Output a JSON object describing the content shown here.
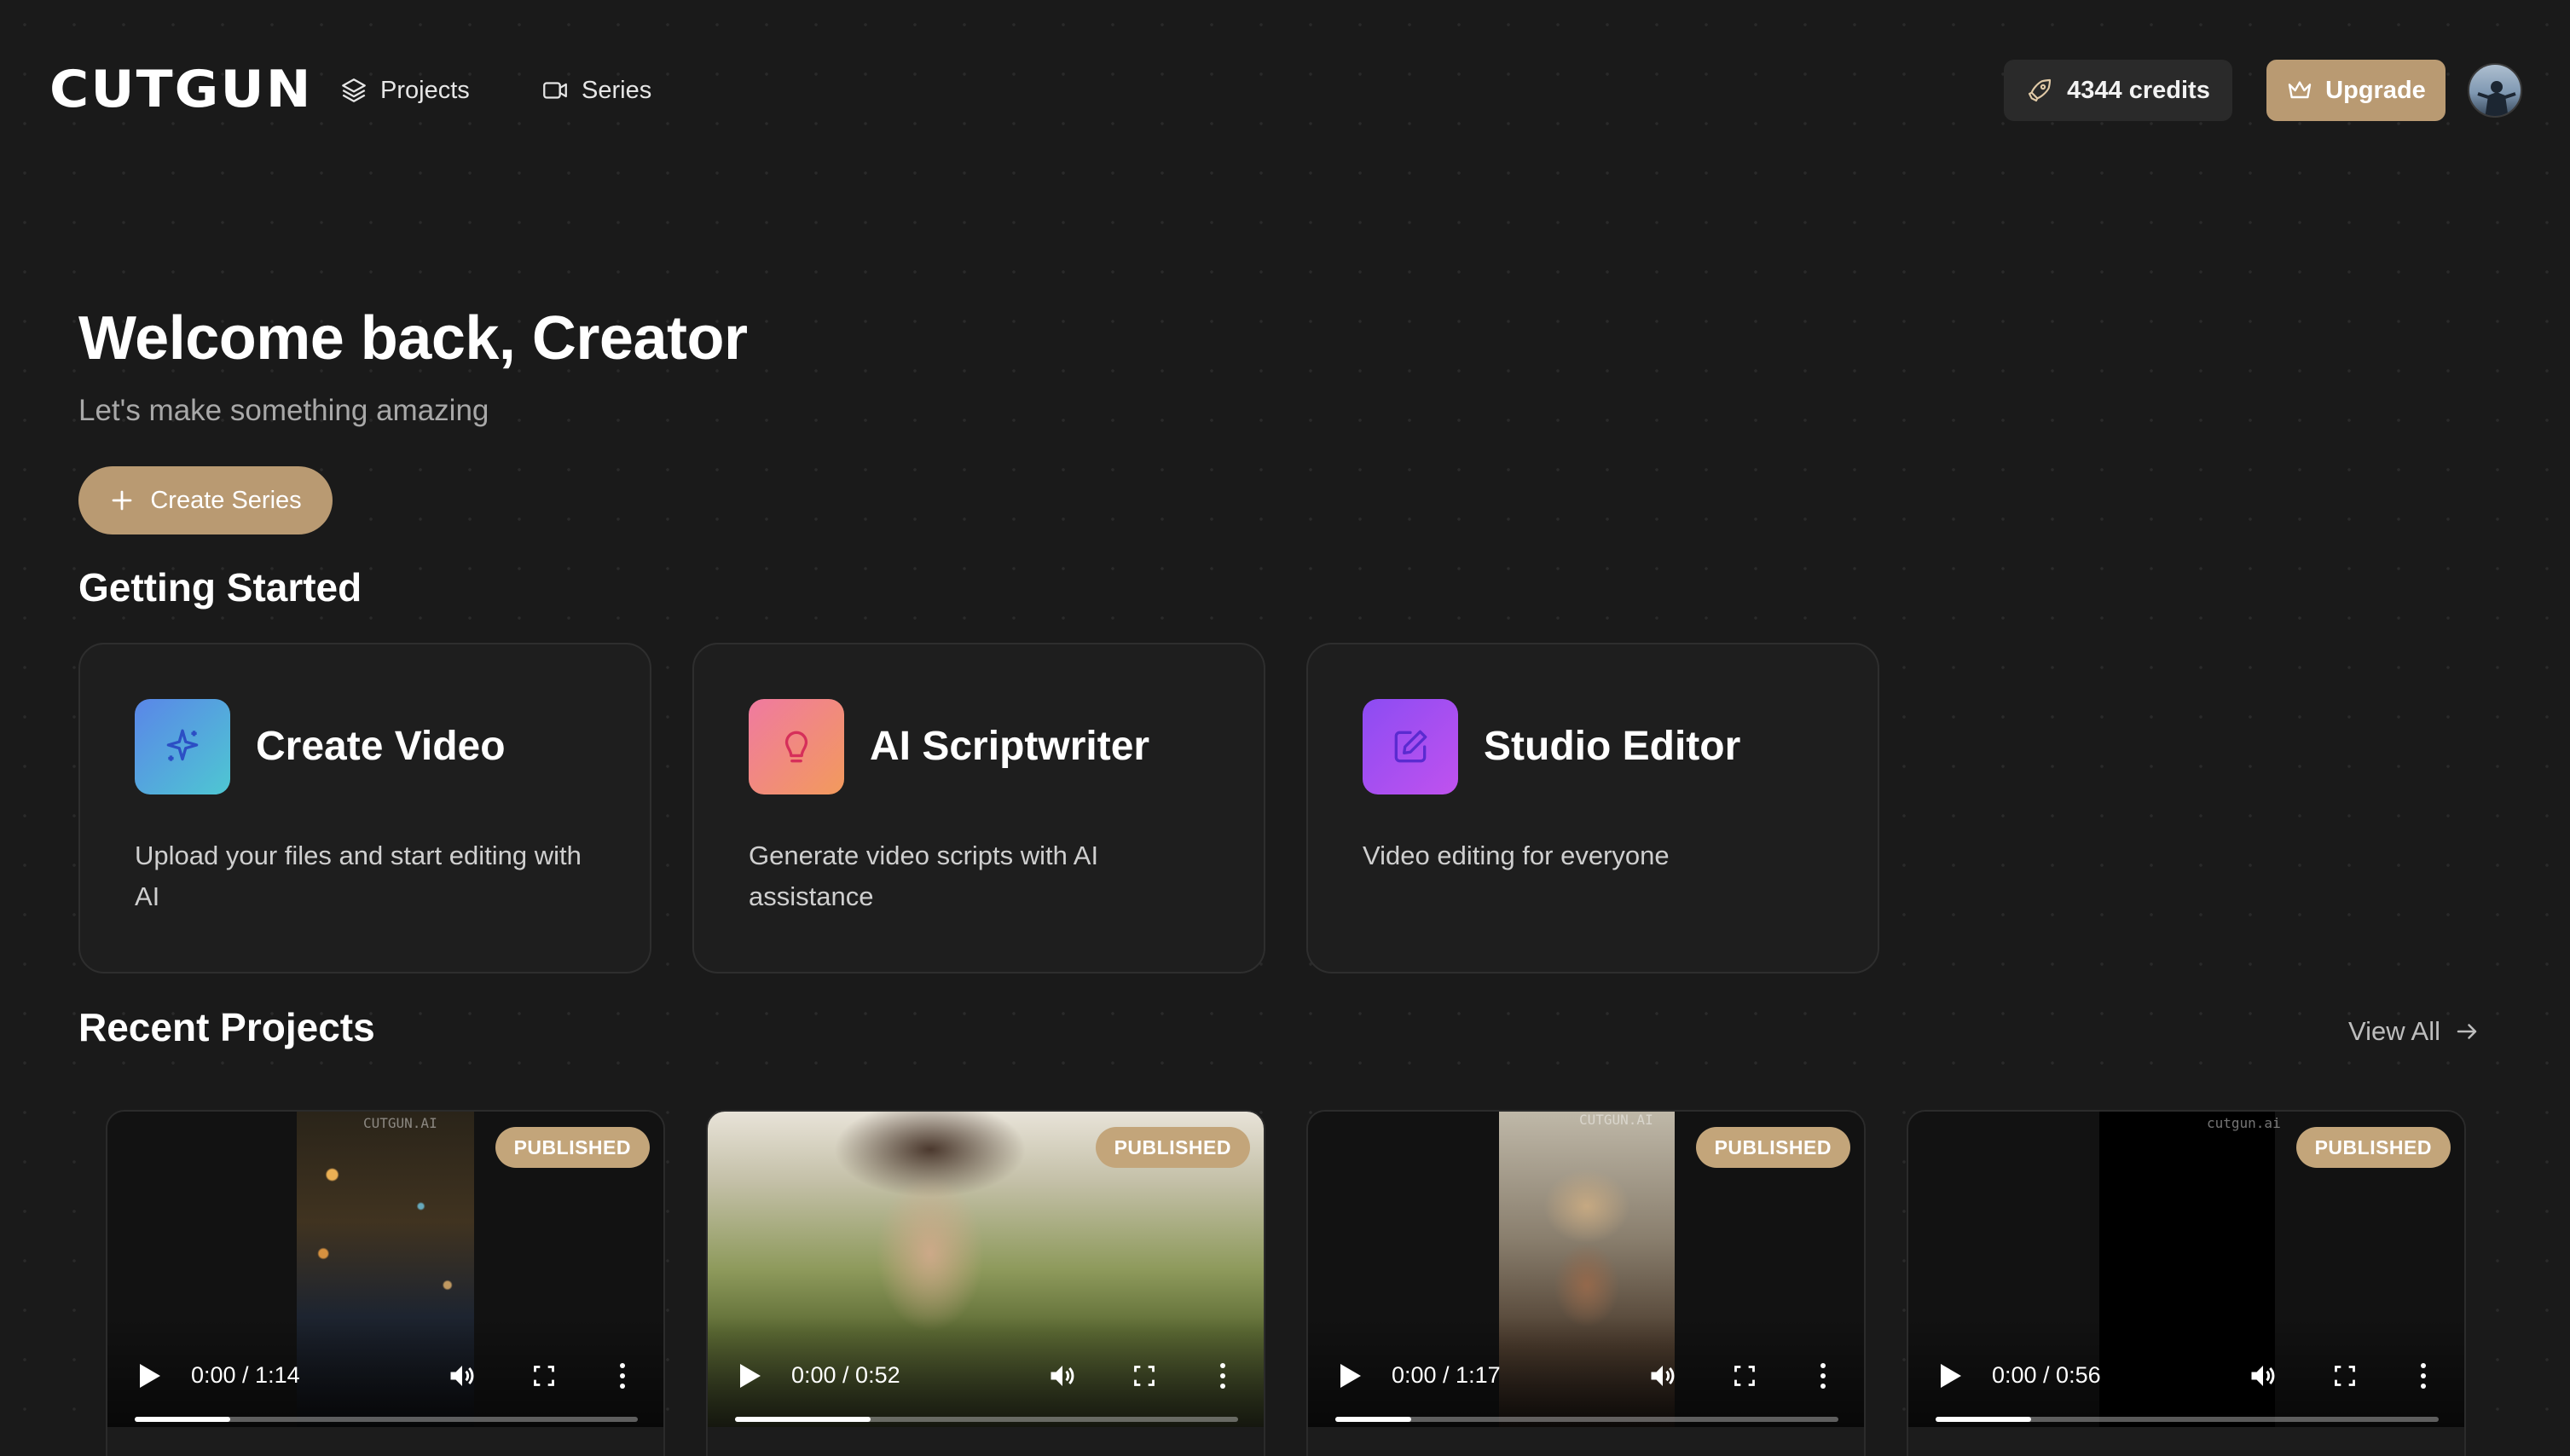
{
  "header": {
    "logo": "CUTGUN",
    "nav": [
      {
        "label": "Projects",
        "icon": "layers-icon"
      },
      {
        "label": "Series",
        "icon": "video-camera-icon"
      }
    ],
    "credits_label": "4344 credits",
    "upgrade_label": "Upgrade"
  },
  "hero": {
    "title": "Welcome back, Creator",
    "subtitle": "Let's make something amazing",
    "create_series_label": "Create Series"
  },
  "getting_started": {
    "title": "Getting Started",
    "cards": [
      {
        "title": "Create Video",
        "description": "Upload your files and start editing with AI",
        "icon": "sparkle-icon",
        "color": "#4fb7d9"
      },
      {
        "title": "AI Scriptwriter",
        "description": "Generate video scripts with AI assistance",
        "icon": "lightbulb-icon",
        "color": "#ef7d8e"
      },
      {
        "title": "Studio Editor",
        "description": "Video editing for everyone",
        "icon": "edit-icon",
        "color": "#a24df0"
      }
    ]
  },
  "recent_projects": {
    "title": "Recent Projects",
    "view_all_label": "View All",
    "videos": [
      {
        "status": "PUBLISHED",
        "time": "0:00 / 1:14",
        "progress": 0.19,
        "watermark": "CUTGUN.AI"
      },
      {
        "status": "PUBLISHED",
        "time": "0:00 / 0:52",
        "progress": 0.27,
        "watermark": ""
      },
      {
        "status": "PUBLISHED",
        "time": "0:00 / 1:17",
        "progress": 0.15,
        "watermark": "CUTGUN.AI"
      },
      {
        "status": "PUBLISHED",
        "time": "0:00 / 0:56",
        "progress": 0.19,
        "watermark": "cutgun.ai"
      }
    ]
  },
  "colors": {
    "background": "#1a1a1a",
    "accent": "#b99a72",
    "card": "#1e1e1e"
  }
}
